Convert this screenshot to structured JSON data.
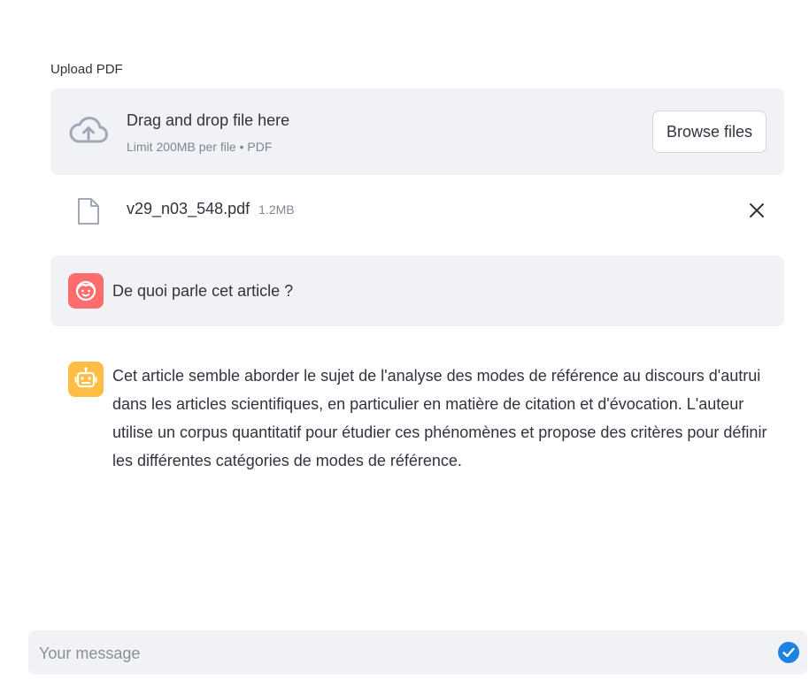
{
  "uploader": {
    "label": "Upload PDF",
    "drop_title": "Drag and drop file here",
    "drop_limit": "Limit 200MB per file • PDF",
    "browse_label": "Browse files",
    "icon": "cloud-upload-icon"
  },
  "file": {
    "name": "v29_n03_548.pdf",
    "size": "1.2MB",
    "icon": "file-icon",
    "remove_icon": "close-icon"
  },
  "chat": {
    "messages": [
      {
        "role": "user",
        "avatar": "user-face-icon",
        "avatar_color": "#ff6c6c",
        "text": "De quoi parle cet article ?"
      },
      {
        "role": "assistant",
        "avatar": "robot-icon",
        "avatar_color": "#ffbd45",
        "text": "Cet article semble aborder le sujet de l'analyse des modes de référence au discours d'autrui dans les articles scientifiques, en particulier en matière de citation et d'évocation. L'auteur utilise un corpus quantitatif pour étudier ces phénomènes et propose des critères pour définir les différentes catégories de modes de référence."
      }
    ]
  },
  "input": {
    "placeholder": "Your message",
    "send_icon": "send-icon"
  },
  "colors": {
    "panel_bg": "#f0f2f6",
    "text": "#31333f",
    "muted": "#808495",
    "send_accent": "#1c83e1"
  }
}
